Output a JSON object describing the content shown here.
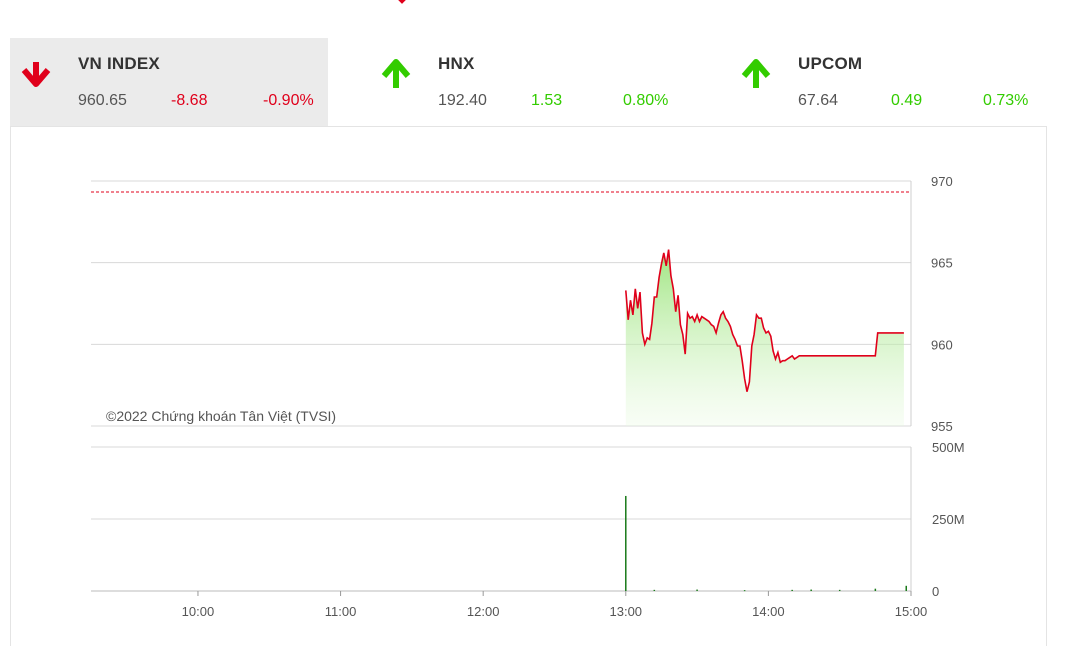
{
  "indices": [
    {
      "name": "VN INDEX",
      "value": "960.65",
      "change": "-8.68",
      "percent": "-0.90%",
      "direction": "down",
      "color": "#e0001b",
      "active": true
    },
    {
      "name": "HNX",
      "value": "192.40",
      "change": "1.53",
      "percent": "0.80%",
      "direction": "up",
      "color": "#33cc00",
      "active": false
    },
    {
      "name": "UPCOM",
      "value": "67.64",
      "change": "0.49",
      "percent": "0.73%",
      "direction": "up",
      "color": "#33cc00",
      "active": false
    }
  ],
  "colors": {
    "down": "#e0001b",
    "up": "#33cc00",
    "line": "#e0001b",
    "volume": "#1a7a1a",
    "neutral": "#555555"
  },
  "chart_data": [
    {
      "type": "line",
      "title": "",
      "watermark": "©2022 Chứng khoán Tân Việt (TVSI)",
      "reference_value": 969.33,
      "ylim": [
        955,
        970
      ],
      "y_ticks": [
        "970",
        "965",
        "960",
        "955"
      ],
      "x_ticks": [
        "10:00",
        "11:00",
        "12:00",
        "13:00",
        "14:00",
        "15:00"
      ],
      "series": [
        {
          "x": [
            "13:00",
            "13:01",
            "13:02",
            "13:03",
            "13:04",
            "13:05",
            "13:06",
            "13:07",
            "13:08",
            "13:09",
            "13:10",
            "13:11",
            "13:12",
            "13:13",
            "13:14",
            "13:15",
            "13:16",
            "13:17",
            "13:18",
            "13:19",
            "13:20",
            "13:21",
            "13:22",
            "13:23",
            "13:24",
            "13:25",
            "13:26",
            "13:27",
            "13:28",
            "13:29",
            "13:30",
            "13:31",
            "13:32",
            "13:33",
            "13:34",
            "13:35",
            "13:36",
            "13:37",
            "13:38",
            "13:39",
            "13:40",
            "13:41",
            "13:42",
            "13:43",
            "13:44",
            "13:45",
            "13:46",
            "13:47",
            "13:48",
            "13:49",
            "13:50",
            "13:51",
            "13:52",
            "13:53",
            "13:54",
            "13:55",
            "13:56",
            "13:57",
            "13:58",
            "13:59",
            "14:00",
            "14:01",
            "14:02",
            "14:03",
            "14:04",
            "14:05",
            "14:06",
            "14:07",
            "14:08",
            "14:09",
            "14:10",
            "14:11",
            "14:12",
            "14:13",
            "14:14",
            "14:15",
            "14:16",
            "14:17",
            "14:18",
            "14:19",
            "14:20",
            "14:21",
            "14:22",
            "14:23",
            "14:24",
            "14:25",
            "14:26",
            "14:27",
            "14:28",
            "14:29",
            "14:30",
            "14:35",
            "14:40",
            "14:45",
            "14:46",
            "14:50",
            "14:55",
            "14:57"
          ],
          "values": [
            963.3,
            961.5,
            962.7,
            961.8,
            963.4,
            962.2,
            963.2,
            960.7,
            960.0,
            960.4,
            960.3,
            961.3,
            962.9,
            962.9,
            964.1,
            964.9,
            965.6,
            964.8,
            965.8,
            964.2,
            963.4,
            962.0,
            963.0,
            961.2,
            960.6,
            959.4,
            961.9,
            961.6,
            961.7,
            961.4,
            961.8,
            961.4,
            961.7,
            961.6,
            961.5,
            961.4,
            961.2,
            961.1,
            960.7,
            961.3,
            961.8,
            962.0,
            961.6,
            961.4,
            961.1,
            960.6,
            960.3,
            959.9,
            959.9,
            959.0,
            957.9,
            957.1,
            957.7,
            959.9,
            960.6,
            961.8,
            961.6,
            961.6,
            961.0,
            960.7,
            960.8,
            960.5,
            959.6,
            959.1,
            959.5,
            958.9,
            959.0,
            959.0,
            959.1,
            959.2,
            959.3,
            959.1,
            959.2,
            959.3,
            959.3,
            959.3,
            959.3,
            959.3,
            959.3,
            959.3,
            959.3,
            959.3,
            959.3,
            959.3,
            959.3,
            959.3,
            959.3,
            959.3,
            959.3,
            959.3,
            959.3,
            959.3,
            959.3,
            959.3,
            960.7,
            960.7,
            960.7,
            960.7
          ]
        }
      ]
    },
    {
      "type": "bar",
      "ylim": [
        0,
        500
      ],
      "y_ticks": [
        "500M",
        "250M",
        "0"
      ],
      "x_ticks": [
        "10:00",
        "11:00",
        "12:00",
        "13:00",
        "14:00",
        "15:00"
      ],
      "series": [
        {
          "x": [
            "13:00",
            "13:12",
            "13:30",
            "13:50",
            "14:10",
            "14:18",
            "14:30",
            "14:45",
            "14:58"
          ],
          "values": [
            330,
            4,
            5,
            3,
            4,
            5,
            4,
            8,
            18
          ]
        }
      ]
    }
  ]
}
